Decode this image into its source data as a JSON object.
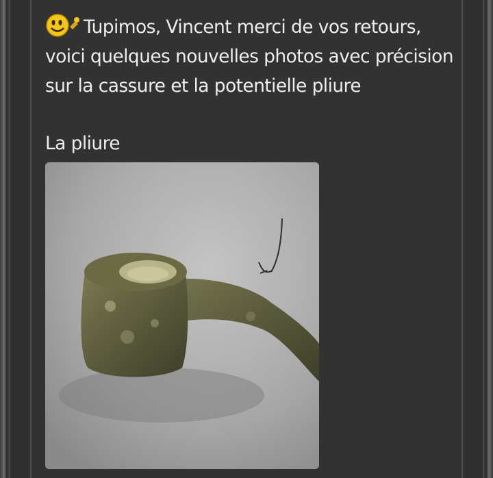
{
  "post": {
    "message_lines": [
      "Tupimos, Vincent merci de vos retours,",
      "voici quelques nouvelles photos avec précision",
      "sur la cassure et la potentielle pliure"
    ],
    "emoji": "smiley-wink-icon",
    "section_label": "La pliure",
    "photo_alt": "photo-pliure"
  },
  "colors": {
    "background": "#323232",
    "text": "#ededed",
    "photo_bg": "#a7a7a7"
  }
}
